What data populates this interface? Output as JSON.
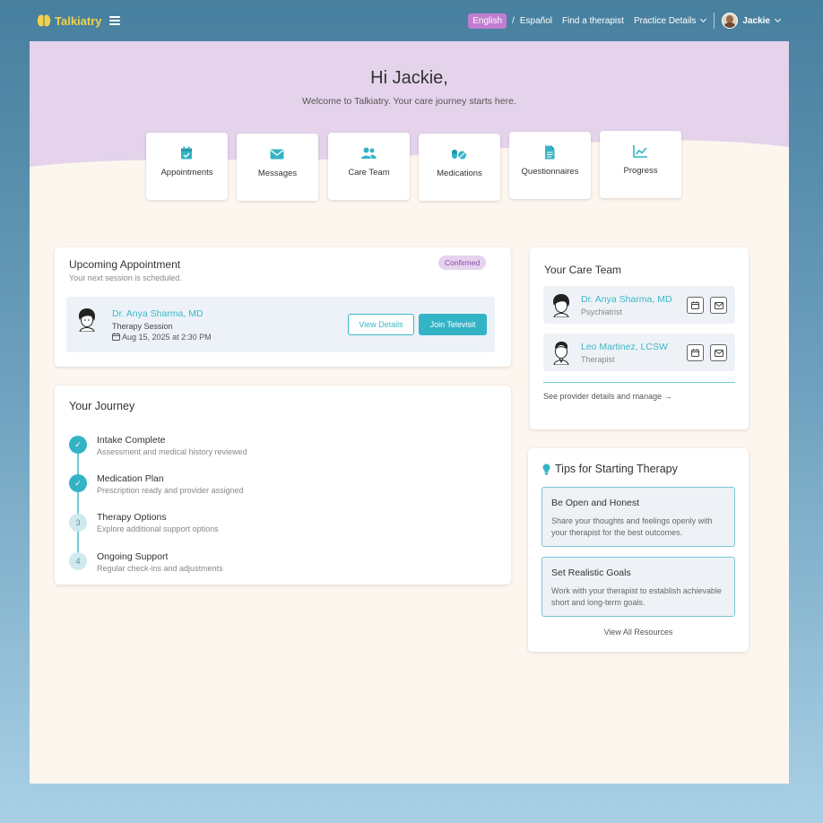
{
  "header": {
    "brand": "Talkiatry",
    "language_active": "English",
    "language_sep": "/",
    "language_alt": "Español",
    "find_therapist": "Find a therapist",
    "practice_details": "Practice Details",
    "user_name": "Jackie"
  },
  "hero": {
    "greeting": "Hi Jackie,",
    "welcome": "Welcome to Talkiatry. Your care journey starts here."
  },
  "quick_links": [
    {
      "label": "Appointments",
      "icon": "calendar-check-icon"
    },
    {
      "label": "Messages",
      "icon": "envelope-icon"
    },
    {
      "label": "Care Team",
      "icon": "users-icon"
    },
    {
      "label": "Medications",
      "icon": "pills-icon"
    },
    {
      "label": "Questionnaires",
      "icon": "document-icon"
    },
    {
      "label": "Progress",
      "icon": "chart-line-icon"
    }
  ],
  "appointment": {
    "title": "Upcoming Appointment",
    "subtitle": "Your next session is scheduled.",
    "status": "Confirmed",
    "provider": "Dr. Anya Sharma, MD",
    "type": "Therapy Session",
    "datetime": "Aug 15, 2025 at 2:30 PM",
    "view_details": "View Details",
    "join": "Join Televisit"
  },
  "journey": {
    "title": "Your Journey",
    "steps": [
      {
        "num": "1",
        "title": "Intake Complete",
        "desc": "Assessment and medical history reviewed",
        "done": true
      },
      {
        "num": "2",
        "title": "Medication Plan",
        "desc": "Prescription ready and provider assigned",
        "done": true
      },
      {
        "num": "3",
        "title": "Therapy Options",
        "desc": "Explore additional support options",
        "done": false
      },
      {
        "num": "4",
        "title": "Ongoing Support",
        "desc": "Regular check-ins and adjustments",
        "done": false
      }
    ]
  },
  "care_team": {
    "title": "Your Care Team",
    "members": [
      {
        "name": "Dr. Anya Sharma, MD",
        "role": "Psychiatrist"
      },
      {
        "name": "Leo Martinez, LCSW",
        "role": "Therapist"
      }
    ],
    "manage_link": "See provider details and manage"
  },
  "tips": {
    "title": "Tips for Starting Therapy",
    "items": [
      {
        "title": "Be Open and Honest",
        "body": "Share your thoughts and feelings openly with your therapist for the best outcomes."
      },
      {
        "title": "Set Realistic Goals",
        "body": "Work with your therapist to establish achievable short and long-term goals."
      }
    ],
    "view_all": "View All Resources"
  },
  "colors": {
    "accent": "#33b4c6",
    "brand_yellow": "#f3d24a",
    "lang_pill": "#c17ed1",
    "hero_lavender": "#e4d3eb",
    "page_bg": "#fdf6ef"
  }
}
